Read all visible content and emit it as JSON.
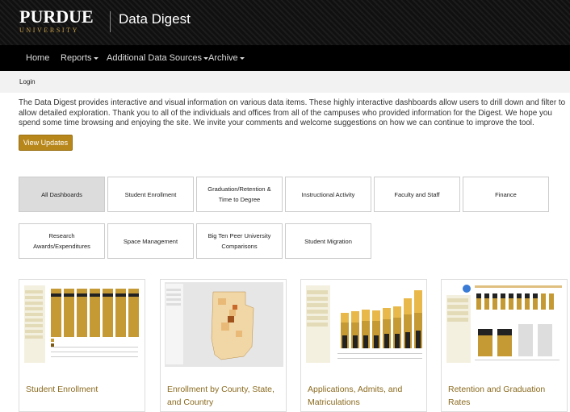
{
  "header": {
    "logo_text": "PURDUE",
    "logo_subtext": "UNIVERSITY",
    "app_title": "Data Digest"
  },
  "nav": {
    "items": [
      {
        "label": "Home",
        "dropdown": false
      },
      {
        "label": "Reports",
        "dropdown": true
      },
      {
        "label": "Additional Data Sources",
        "dropdown": true
      },
      {
        "label": "Archive",
        "dropdown": true
      }
    ]
  },
  "subbar": {
    "login_label": "Login"
  },
  "intro": {
    "text": "The Data Digest provides interactive and visual information on various data items. These highly interactive dashboards allow users to drill down and filter to allow detailed exploration. Thank you to all of the individuals and offices from all of the campuses who provided information for the Digest. We hope you spend some time browsing and enjoying the site. We invite your comments and welcome suggestions on how we can continue to improve the tool.",
    "button_label": "View Updates"
  },
  "filters": [
    {
      "label": "All Dashboards",
      "active": true
    },
    {
      "label": "Student Enrollment",
      "active": false
    },
    {
      "label": "Graduation/Retention & Time to Degree",
      "active": false
    },
    {
      "label": "Instructional Activity",
      "active": false
    },
    {
      "label": "Faculty and Staff",
      "active": false
    },
    {
      "label": "Finance",
      "active": false
    },
    {
      "label": "Research Awards/Expenditures",
      "active": false
    },
    {
      "label": "Space Management",
      "active": false
    },
    {
      "label": "Big Ten Peer University Comparisons",
      "active": false
    },
    {
      "label": "Student Migration",
      "active": false
    }
  ],
  "cards": [
    {
      "title": "Student Enrollment"
    },
    {
      "title": "Enrollment by County, State, and Country"
    },
    {
      "title": "Applications, Admits, and Matriculations"
    },
    {
      "title": "Retention and Graduation Rates"
    }
  ],
  "colors": {
    "brand_gold": "#b8871b",
    "header_dark": "#111111",
    "nav_black": "#000000",
    "card_title": "#8a6a1e"
  }
}
